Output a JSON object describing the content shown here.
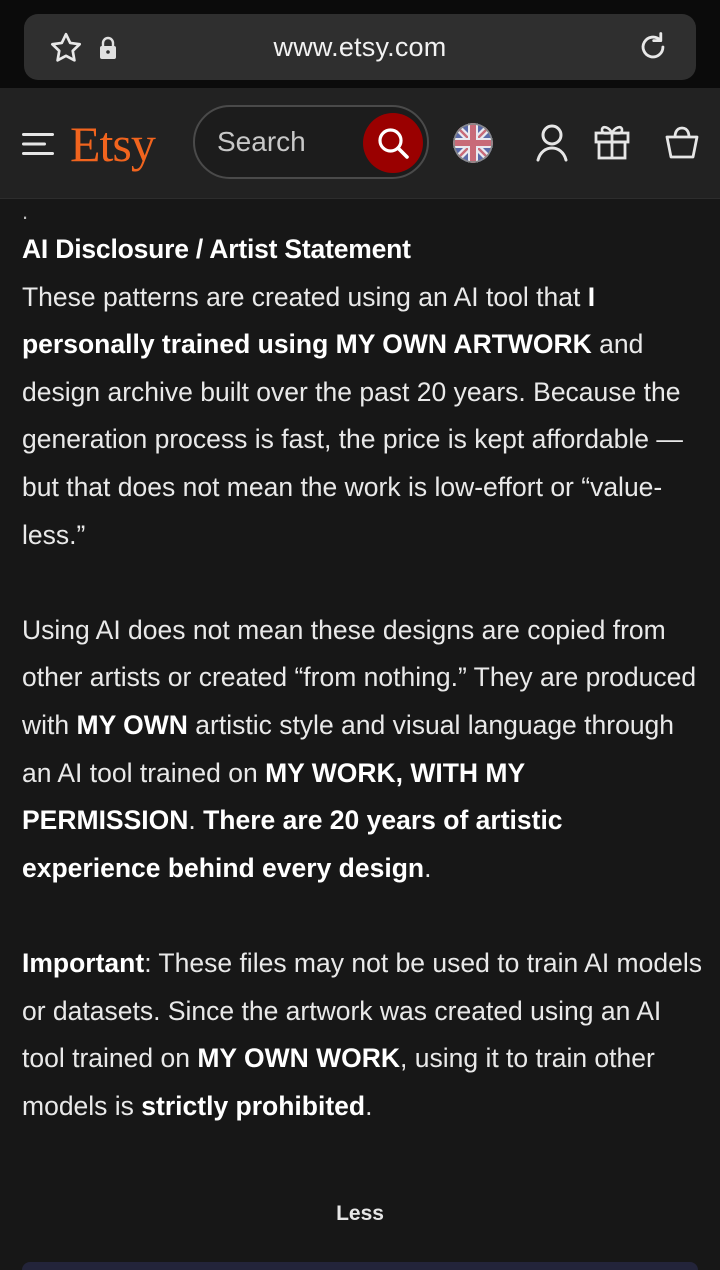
{
  "browser": {
    "url": "www.etsy.com",
    "icons": [
      "star-icon",
      "lock-icon",
      "reload-icon"
    ]
  },
  "header": {
    "logo": "Etsy",
    "search": {
      "placeholder": "Search"
    },
    "icons": [
      "hamburger-icon",
      "search-icon",
      "flag-icon",
      "user-icon",
      "gift-icon",
      "bag-icon"
    ],
    "brand_color": "#f1641e",
    "search_button_color": "#9a0000"
  },
  "description": {
    "dot": ".",
    "heading": "AI Disclosure / Artist Statement",
    "p1": {
      "t1": "These patterns are created using an AI tool that ",
      "b1": "I personally trained using MY OWN ARTWORK",
      "t2": " and design archive built over the past 20 years. Because the generation process is fast, the price is kept affordable — but that does not mean the work is low-effort or “value-less.”"
    },
    "p2": {
      "t1": "Using AI does not mean these designs are copied from other artists or created “from nothing.” They are produced with ",
      "b1": "MY OWN",
      "t2": " artistic style and visual language through an AI tool trained on ",
      "b2": "MY WORK, WITH MY PERMISSION",
      "t3": ". ",
      "b3": "There are 20 years of artistic experience behind every design",
      "t4": "."
    },
    "p3": {
      "b1": "Important",
      "t1": ": These files may not be used to train AI models or datasets. Since the artwork was created using an AI tool trained on ",
      "b2": "MY OWN WORK",
      "t2": ", using it to train other models is ",
      "b3": "strictly prohibited",
      "t3": "."
    },
    "less_label": "Less"
  }
}
